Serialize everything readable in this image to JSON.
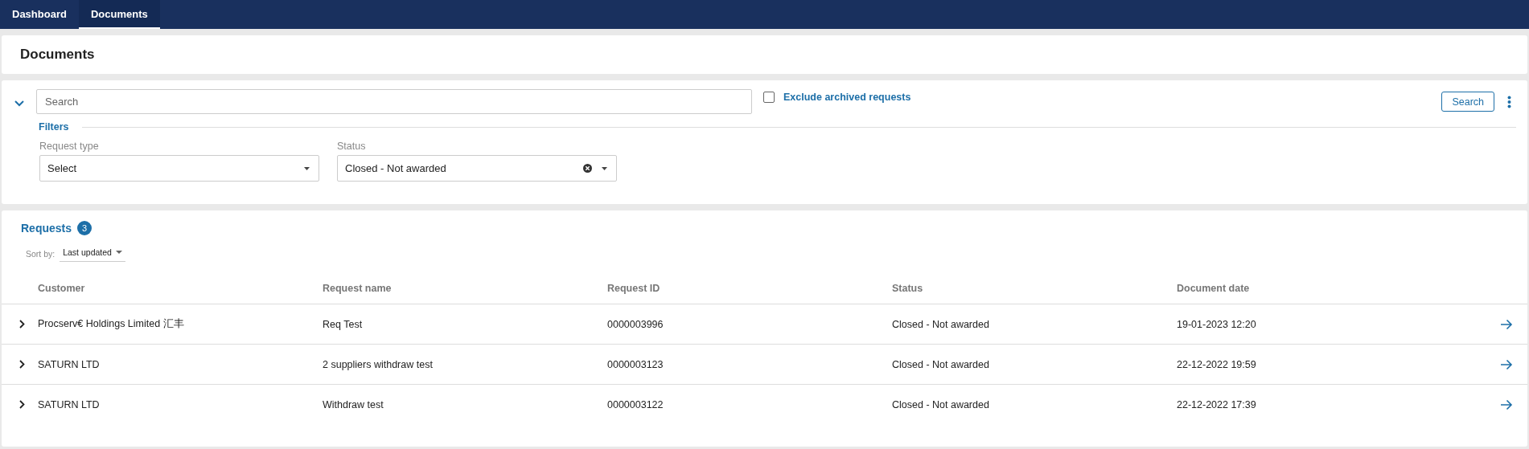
{
  "tabs": [
    {
      "label": "Dashboard",
      "selected": false
    },
    {
      "label": "Documents",
      "selected": true
    }
  ],
  "page_title": "Documents",
  "search": {
    "placeholder": "Search",
    "expanded": true,
    "exclude_archived": {
      "label": "Exclude archived requests",
      "checked": false
    },
    "button": "Search"
  },
  "filters": {
    "title": "Filters",
    "fields": [
      {
        "label": "Request type",
        "value": "Select",
        "clearable": false
      },
      {
        "label": "Status",
        "value": "Closed - Not awarded",
        "clearable": true
      }
    ]
  },
  "requests": {
    "title": "Requests",
    "count": "3",
    "sort_label": "Sort by:",
    "sort_value": "Last updated",
    "columns": [
      "Customer",
      "Request name",
      "Request ID",
      "Status",
      "Document date"
    ],
    "rows": [
      {
        "customer": "Procserv€ Holdings Limited 汇丰",
        "request_name": "Req Test",
        "request_id": "0000003996",
        "status": "Closed - Not awarded",
        "document_date": "19-01-2023 12:20"
      },
      {
        "customer": "SATURN LTD",
        "request_name": "2 suppliers withdraw test",
        "request_id": "0000003123",
        "status": "Closed - Not awarded",
        "document_date": "22-12-2022 19:59"
      },
      {
        "customer": "SATURN LTD",
        "request_name": "Withdraw test",
        "request_id": "0000003122",
        "status": "Closed - Not awarded",
        "document_date": "22-12-2022 17:39"
      }
    ]
  }
}
